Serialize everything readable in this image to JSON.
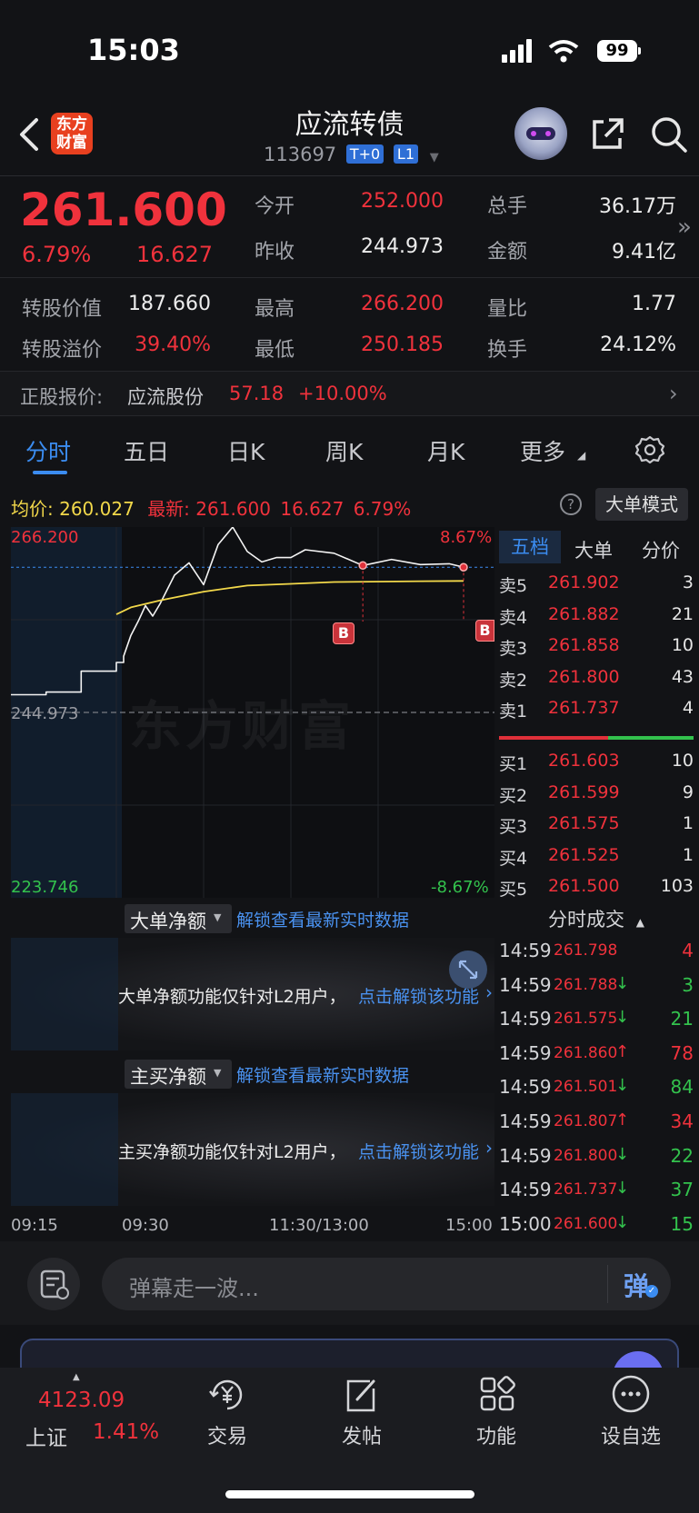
{
  "status_bar": {
    "time": "15:03",
    "battery": "99"
  },
  "header": {
    "logo_text": "东方财富",
    "title": "应流转债",
    "code": "113697",
    "tags": [
      "T+0",
      "L1"
    ]
  },
  "quote": {
    "price": "261.600",
    "change_pct": "6.79%",
    "change": "16.627",
    "open_label": "今开",
    "open": "252.000",
    "prev_close_label": "昨收",
    "prev_close": "244.973",
    "volume_label": "总手",
    "volume": "36.17万",
    "amount_label": "金额",
    "amount": "9.41亿",
    "conv_value_label": "转股价值",
    "conv_value": "187.660",
    "high_label": "最高",
    "high": "266.200",
    "volume_ratio_label": "量比",
    "volume_ratio": "1.77",
    "premium_label": "转股溢价",
    "premium": "39.40%",
    "low_label": "最低",
    "low": "250.185",
    "turnover_label": "换手",
    "turnover": "24.12%"
  },
  "stock_line": {
    "label": "正股报价:",
    "name": "应流股份",
    "price": "57.18",
    "change": "+10.00%"
  },
  "tabs": [
    "分时",
    "五日",
    "日K",
    "周K",
    "月K",
    "更多"
  ],
  "chart_header": {
    "avg_label": "均价:",
    "avg": "260.027",
    "latest_label": "最新:",
    "latest": "261.600",
    "change": "16.627",
    "change_pct": "6.79%",
    "big_order_mode": "大单模式"
  },
  "chart": {
    "top_price": "266.200",
    "mid_price": "244.973",
    "bottom_price": "223.746",
    "top_pct": "8.67%",
    "bottom_pct": "-8.67%",
    "watermark": "东方财富",
    "markers": [
      "B",
      "B"
    ],
    "time_labels": [
      "09:15",
      "09:30",
      "11:30/13:00",
      "15:00"
    ]
  },
  "chart_data": {
    "type": "line",
    "ylim": [
      223.746,
      266.2
    ],
    "series": [
      {
        "name": "最新",
        "x": [
          "09:15",
          "09:20",
          "09:25",
          "09:30",
          "09:35",
          "09:40",
          "09:45",
          "09:50",
          "09:55",
          "10:00",
          "10:10",
          "10:20",
          "10:30",
          "10:40",
          "10:50",
          "11:00",
          "11:10",
          "11:20",
          "11:30",
          "13:10",
          "13:30",
          "13:50",
          "14:10",
          "14:30",
          "14:50",
          "15:00"
        ],
        "values": [
          247.0,
          247.3,
          249.7,
          250.7,
          251.4,
          253.8,
          255.4,
          257.2,
          256.0,
          257.4,
          260.7,
          262.1,
          259.6,
          264.2,
          266.2,
          263.4,
          262.2,
          262.7,
          262.7,
          263.6,
          263.2,
          261.8,
          262.5,
          261.9,
          262.0,
          261.6
        ]
      },
      {
        "name": "均价",
        "x": [
          "09:30",
          "09:40",
          "10:00",
          "10:30",
          "11:00",
          "11:30",
          "13:30",
          "14:30",
          "15:00"
        ],
        "values": [
          256.2,
          257.0,
          257.8,
          258.8,
          259.5,
          259.7,
          259.9,
          260.0,
          260.027
        ]
      }
    ]
  },
  "order_book": {
    "tabs": [
      "五档",
      "大单",
      "分价"
    ],
    "asks": [
      {
        "label": "卖5",
        "price": "261.902",
        "vol": "3"
      },
      {
        "label": "卖4",
        "price": "261.882",
        "vol": "21"
      },
      {
        "label": "卖3",
        "price": "261.858",
        "vol": "10"
      },
      {
        "label": "卖2",
        "price": "261.800",
        "vol": "43"
      },
      {
        "label": "卖1",
        "price": "261.737",
        "vol": "4"
      }
    ],
    "bids": [
      {
        "label": "买1",
        "price": "261.603",
        "vol": "10"
      },
      {
        "label": "买2",
        "price": "261.599",
        "vol": "9"
      },
      {
        "label": "买3",
        "price": "261.575",
        "vol": "1"
      },
      {
        "label": "买4",
        "price": "261.525",
        "vol": "1"
      },
      {
        "label": "买5",
        "price": "261.500",
        "vol": "103"
      }
    ]
  },
  "trades": {
    "title": "分时成交",
    "rows": [
      {
        "time": "14:59",
        "price": "261.798",
        "arrow": "",
        "vol": "4",
        "color": "red"
      },
      {
        "time": "14:59",
        "price": "261.788",
        "arrow": "↓",
        "vol": "3",
        "color": "green"
      },
      {
        "time": "14:59",
        "price": "261.575",
        "arrow": "↓",
        "vol": "21",
        "color": "green"
      },
      {
        "time": "14:59",
        "price": "261.860",
        "arrow": "↑",
        "vol": "78",
        "color": "red"
      },
      {
        "time": "14:59",
        "price": "261.501",
        "arrow": "↓",
        "vol": "84",
        "color": "green"
      },
      {
        "time": "14:59",
        "price": "261.807",
        "arrow": "↑",
        "vol": "34",
        "color": "red"
      },
      {
        "time": "14:59",
        "price": "261.800",
        "arrow": "↓",
        "vol": "22",
        "color": "green"
      },
      {
        "time": "14:59",
        "price": "261.737",
        "arrow": "↓",
        "vol": "37",
        "color": "green"
      },
      {
        "time": "15:00",
        "price": "261.600",
        "arrow": "↓",
        "vol": "15",
        "color": "green"
      }
    ]
  },
  "panels": [
    {
      "selector": "大单净额",
      "unlock": "解锁查看最新实时数据",
      "msg": "大单净额功能仅针对L2用户，",
      "link": "点击解锁该功能"
    },
    {
      "selector": "主买净额",
      "unlock": "解锁查看最新实时数据",
      "msg": "主买净额功能仅针对L2用户，",
      "link": "点击解锁该功能"
    }
  ],
  "danmu": {
    "placeholder": "弹幕走一波...",
    "button": "弹"
  },
  "navbar": {
    "index_value": "4123.09",
    "index_name": "上证",
    "index_pct": "1.41%",
    "items": [
      "交易",
      "发帖",
      "功能",
      "设自选"
    ]
  },
  "colors": {
    "up": "#f0323c",
    "down": "#33c24d",
    "avg": "#f2d84a",
    "accent": "#3b8cf0"
  }
}
